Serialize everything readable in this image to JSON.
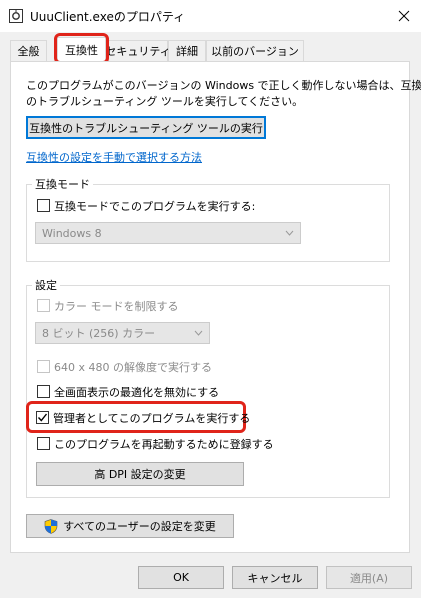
{
  "window": {
    "title": "UuuClient.exeのプロパティ"
  },
  "tabs": [
    {
      "label": "全般"
    },
    {
      "label": "互換性"
    },
    {
      "label": "セキュリティ"
    },
    {
      "label": "詳細"
    },
    {
      "label": "以前のバージョン"
    }
  ],
  "intro": {
    "line1": "このプログラムがこのバージョンの Windows で正しく動作しない場合は、互換性",
    "line2": "のトラブルシューティング ツールを実行してください。"
  },
  "troubleshoot_button": "互換性のトラブルシューティング ツールの実行",
  "manual_link": "互換性の設定を手動で選択する方法",
  "compat_mode": {
    "legend": "互換モード",
    "checkbox_label": "互換モードでこのプログラムを実行する:",
    "checked": false,
    "os_value": "Windows 8"
  },
  "settings": {
    "legend": "設定",
    "reduced_color": {
      "label": "カラー モードを制限する",
      "checked": false,
      "enabled": false
    },
    "color_value": "8 ビット (256) カラー",
    "res_640": {
      "label": "640 x 480 の解像度で実行する",
      "checked": false,
      "enabled": false
    },
    "disable_fullscreen": {
      "label": "全画面表示の最適化を無効にする",
      "checked": false
    },
    "run_as_admin": {
      "label": "管理者としてこのプログラムを実行する",
      "checked": true
    },
    "register_restart": {
      "label": "このプログラムを再起動するために登録する",
      "checked": false
    },
    "dpi_button": "高 DPI 設定の変更"
  },
  "all_users_button": "すべてのユーザーの設定を変更",
  "footer": {
    "ok": "OK",
    "cancel": "キャンセル",
    "apply": "適用(A)"
  },
  "colors": {
    "highlight": "#e0241a",
    "link": "#0066cc",
    "focus": "#0078d7"
  },
  "icons": [
    "app-icon",
    "close-icon",
    "chevron-down-icon",
    "checkmark-icon",
    "shield-icon"
  ]
}
